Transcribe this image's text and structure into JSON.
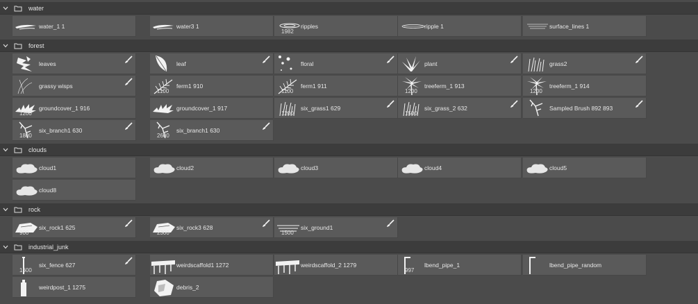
{
  "colors": {
    "panel_bg": "#4b4b4b",
    "header_bg": "#3c3c3c",
    "tile_bg": "#5a5a5a",
    "text": "#e6e6e6"
  },
  "groups": [
    {
      "name": "water",
      "brushes": [
        {
          "name": "water_1 1",
          "size": "",
          "icon": "water-streak-icon",
          "badge": false
        },
        {
          "name": "water3 1",
          "size": "",
          "icon": "water-streak-icon",
          "badge": false
        },
        {
          "name": "ripples",
          "size": "1982",
          "icon": "ripples-icon",
          "badge": false
        },
        {
          "name": "ripple 1",
          "size": "",
          "icon": "ripple-icon",
          "badge": false
        },
        {
          "name": "surface_lines 1",
          "size": "",
          "icon": "surface-lines-icon",
          "badge": false
        }
      ]
    },
    {
      "name": "forest",
      "brushes": [
        {
          "name": "leaves",
          "size": "",
          "icon": "leaves-icon",
          "badge": true
        },
        {
          "name": "leaf",
          "size": "",
          "icon": "leaf-icon",
          "badge": true
        },
        {
          "name": "floral",
          "size": "",
          "icon": "floral-icon",
          "badge": true
        },
        {
          "name": "plant",
          "size": "",
          "icon": "plant-icon",
          "badge": true
        },
        {
          "name": "grass2",
          "size": "",
          "icon": "grass-icon",
          "badge": true
        },
        {
          "name": "grassy wisps",
          "size": "",
          "icon": "grassy-wisps-icon",
          "badge": true
        },
        {
          "name": "ferm1 910",
          "size": "1100",
          "icon": "fern-icon",
          "badge": false
        },
        {
          "name": "ferm1 911",
          "size": "1100",
          "icon": "fern-icon",
          "badge": false
        },
        {
          "name": "treeferm_1 913",
          "size": "1200",
          "icon": "palm-icon",
          "badge": false
        },
        {
          "name": "treeferm_1 914",
          "size": "1200",
          "icon": "palm-icon",
          "badge": false
        },
        {
          "name": "groundcover_1 916",
          "size": "1200",
          "icon": "groundcover-icon",
          "badge": false
        },
        {
          "name": "groundcover_1 917",
          "size": "",
          "icon": "groundcover-icon",
          "badge": false
        },
        {
          "name": "six_grass1 629",
          "size": "1200",
          "icon": "grass-icon",
          "badge": true
        },
        {
          "name": "six_grass_2 632",
          "size": "1500",
          "icon": "grass-icon",
          "badge": true
        },
        {
          "name": "Sampled Brush 892 893",
          "size": "",
          "icon": "branch-icon",
          "badge": true
        },
        {
          "name": "six_branch1 630",
          "size": "1800",
          "icon": "branch-icon",
          "badge": true
        },
        {
          "name": "six_branch1 630",
          "size": "2600",
          "icon": "branch-icon",
          "badge": true
        }
      ]
    },
    {
      "name": "clouds",
      "brushes": [
        {
          "name": "cloud1",
          "size": "",
          "icon": "cloud-icon",
          "badge": false
        },
        {
          "name": "cloud2",
          "size": "",
          "icon": "cloud-icon",
          "badge": false
        },
        {
          "name": "cloud3",
          "size": "",
          "icon": "cloud-icon",
          "badge": false
        },
        {
          "name": "cloud4",
          "size": "",
          "icon": "cloud-icon",
          "badge": false
        },
        {
          "name": "cloud5",
          "size": "",
          "icon": "cloud-icon",
          "badge": false
        },
        {
          "name": "cloud8",
          "size": "",
          "icon": "cloud-icon",
          "badge": false
        }
      ]
    },
    {
      "name": "rock",
      "brushes": [
        {
          "name": "six_rock1 625",
          "size": "900",
          "icon": "rock-icon",
          "badge": true
        },
        {
          "name": "six_rock3 628",
          "size": "2300",
          "icon": "rock-icon",
          "badge": true
        },
        {
          "name": "six_ground1",
          "size": "1500",
          "icon": "ground-icon",
          "badge": true
        }
      ]
    },
    {
      "name": "industrial_junk",
      "brushes": [
        {
          "name": "six_fence 627",
          "size": "1600",
          "icon": "fence-icon",
          "badge": true
        },
        {
          "name": "weirdscaffold1 1272",
          "size": "",
          "icon": "scaffold-icon",
          "badge": false
        },
        {
          "name": "weirdscaffold_2 1279",
          "size": "",
          "icon": "scaffold-icon",
          "badge": false
        },
        {
          "name": "lbend_pipe_1",
          "size": "997",
          "icon": "pipe-icon",
          "badge": false
        },
        {
          "name": "lbend_pipe_random",
          "size": "",
          "icon": "pipe-icon",
          "badge": false
        },
        {
          "name": "weirdpost_1 1275",
          "size": "",
          "icon": "post-icon",
          "badge": false
        },
        {
          "name": "debris_2",
          "size": "",
          "icon": "debris-icon",
          "badge": false
        }
      ]
    }
  ]
}
